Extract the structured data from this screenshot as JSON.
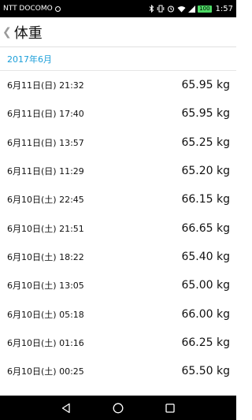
{
  "status_bar": {
    "carrier": "NTT DOCOMO",
    "battery": "100",
    "time": "1:57",
    "icons": [
      "bluetooth-icon",
      "vibrate-icon",
      "alarm-icon",
      "wifi-icon",
      "signal-icon",
      "battery-icon"
    ]
  },
  "app_bar": {
    "back_glyph": "❮",
    "title": "体重"
  },
  "section": {
    "header": "2017年6月"
  },
  "entries": [
    {
      "date": "6月11日(日) 21:32",
      "weight": "65.95 kg"
    },
    {
      "date": "6月11日(日) 17:40",
      "weight": "65.95 kg"
    },
    {
      "date": "6月11日(日) 13:57",
      "weight": "65.25 kg"
    },
    {
      "date": "6月11日(日) 11:29",
      "weight": "65.20 kg"
    },
    {
      "date": "6月10日(土) 22:45",
      "weight": "66.15 kg"
    },
    {
      "date": "6月10日(土) 21:51",
      "weight": "66.65 kg"
    },
    {
      "date": "6月10日(土) 18:22",
      "weight": "65.40 kg"
    },
    {
      "date": "6月10日(土) 13:05",
      "weight": "65.00 kg"
    },
    {
      "date": "6月10日(土) 05:18",
      "weight": "66.00 kg"
    },
    {
      "date": "6月10日(土) 01:16",
      "weight": "66.25 kg"
    },
    {
      "date": "6月10日(土) 00:25",
      "weight": "65.50 kg"
    }
  ],
  "nav_bar": {
    "icons": [
      "back-triangle-icon",
      "home-circle-icon",
      "recents-square-icon"
    ]
  },
  "colors": {
    "accent": "#1a9ed9",
    "status_bar": "#000000",
    "battery": "#4cd964"
  }
}
